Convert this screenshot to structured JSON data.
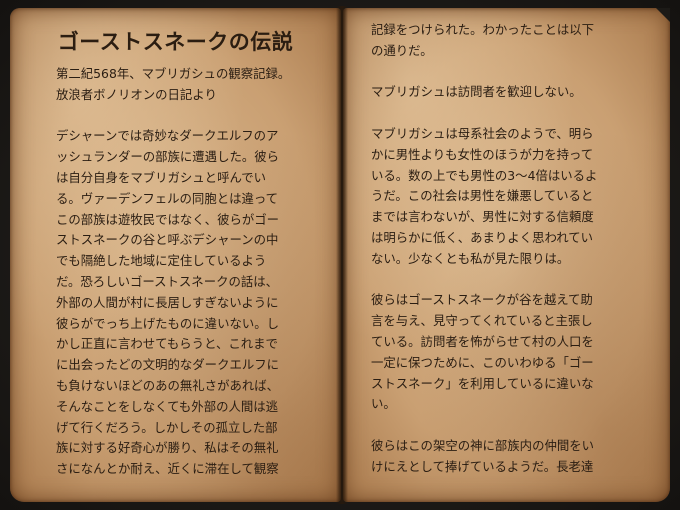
{
  "book": {
    "left_page": {
      "title": "ゴーストスネークの伝説",
      "lines": [
        "第二紀568年、マブリガシュの観察記録。",
        "放浪者ボノリオンの日記より",
        "",
        "デシャーンでは奇妙なダークエルフのア",
        "ッシュランダーの部族に遭遇した。彼ら",
        "は自分自身をマブリガシュと呼んでい",
        "る。ヴァーデンフェルの同胞とは違って",
        "この部族は遊牧民ではなく、彼らがゴー",
        "ストスネークの谷と呼ぶデシャーンの中",
        "でも隔絶した地域に定住しているよう",
        "だ。恐ろしいゴーストスネークの話は、",
        "外部の人間が村に長居しすぎないように",
        "彼らがでっち上げたものに違いない。し",
        "かし正直に言わせてもらうと、これまで",
        "に出会ったどの文明的なダークエルフに",
        "も負けないほどのあの無礼さがあれば、",
        "そんなことをしなくても外部の人間は逃",
        "げて行くだろう。しかしその孤立した部",
        "族に対する好奇心が勝り、私はその無礼",
        "さになんとか耐え、近くに滞在して観察"
      ]
    },
    "right_page": {
      "lines": [
        "記録をつけられた。わかったことは以下",
        "の通りだ。",
        "",
        "マブリガシュは訪問者を歓迎しない。",
        "",
        "マブリガシュは母系社会のようで、明ら",
        "かに男性よりも女性のほうが力を持って",
        "いる。数の上でも男性の3～4倍はいるよ",
        "うだ。この社会は男性を嫌悪していると",
        "までは言わないが、男性に対する信頼度",
        "は明らかに低く、あまりよく思われてい",
        "ない。少なくとも私が見た限りは。",
        "",
        "彼らはゴーストスネークが谷を越えて助",
        "言を与え、見守ってくれていると主張し",
        "ている。訪問者を怖がらせて村の人口を",
        "一定に保つために、このいわゆる「ゴー",
        "ストスネーク」を利用しているに違いな",
        "い。",
        "",
        "彼らはこの架空の神に部族内の仲間をい",
        "けにえとして捧げているようだ。長老達"
      ]
    }
  }
}
